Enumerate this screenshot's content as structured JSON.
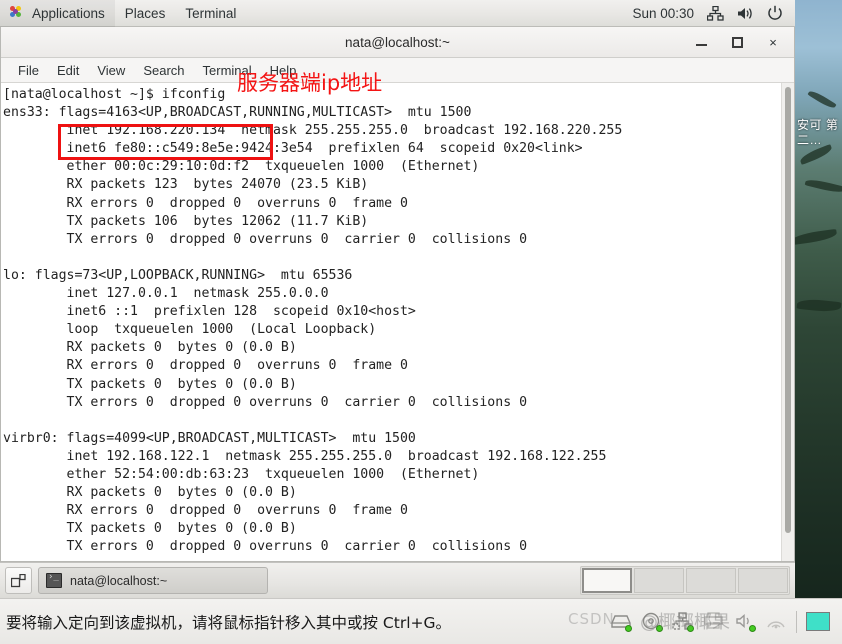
{
  "top_panel": {
    "applications_label": "Applications",
    "places_label": "Places",
    "terminal_label": "Terminal",
    "clock": "Sun 00:30",
    "icons": [
      "network-icon",
      "volume-icon",
      "power-icon"
    ]
  },
  "window": {
    "title": "nata@localhost:~",
    "menu": [
      "File",
      "Edit",
      "View",
      "Search",
      "Terminal",
      "Help"
    ],
    "buttons": {
      "minimize": "minimize-button",
      "maximize": "maximize-button",
      "close": "×"
    }
  },
  "terminal": {
    "lines": [
      "[nata@localhost ~]$ ifconfig",
      "ens33: flags=4163<UP,BROADCAST,RUNNING,MULTICAST>  mtu 1500",
      "        inet 192.168.220.134  netmask 255.255.255.0  broadcast 192.168.220.255",
      "        inet6 fe80::c549:8e5e:9424:3e54  prefixlen 64  scopeid 0x20<link>",
      "        ether 00:0c:29:10:0d:f2  txqueuelen 1000  (Ethernet)",
      "        RX packets 123  bytes 24070 (23.5 KiB)",
      "        RX errors 0  dropped 0  overruns 0  frame 0",
      "        TX packets 106  bytes 12062 (11.7 KiB)",
      "        TX errors 0  dropped 0 overruns 0  carrier 0  collisions 0",
      "",
      "lo: flags=73<UP,LOOPBACK,RUNNING>  mtu 65536",
      "        inet 127.0.0.1  netmask 255.0.0.0",
      "        inet6 ::1  prefixlen 128  scopeid 0x10<host>",
      "        loop  txqueuelen 1000  (Local Loopback)",
      "        RX packets 0  bytes 0 (0.0 B)",
      "        RX errors 0  dropped 0  overruns 0  frame 0",
      "        TX packets 0  bytes 0 (0.0 B)",
      "        TX errors 0  dropped 0 overruns 0  carrier 0  collisions 0",
      "",
      "virbr0: flags=4099<UP,BROADCAST,MULTICAST>  mtu 1500",
      "        inet 192.168.122.1  netmask 255.255.255.0  broadcast 192.168.122.255",
      "        ether 52:54:00:db:63:23  txqueuelen 1000  (Ethernet)",
      "        RX packets 0  bytes 0 (0.0 B)",
      "        RX errors 0  dropped 0  overruns 0  frame 0",
      "        TX packets 0  bytes 0 (0.0 B)",
      "        TX errors 0  dropped 0 overruns 0  carrier 0  collisions 0"
    ]
  },
  "annotation": {
    "note_text": "服务器端ip地址",
    "note_color": "#f41414",
    "highlight_target": "inet 192.168.220.134",
    "box_color": "#ee1111"
  },
  "taskbar": {
    "show_desktop": "show-desktop-button",
    "window_item": "nata@localhost:~",
    "workspace_count": 4,
    "active_workspace": 1
  },
  "vm_status": {
    "message": "要将输入定向到该虚拟机，请将鼠标指针移入其中或按 Ctrl+G。",
    "devices": [
      "harddisk-icon",
      "cdrom-icon",
      "network-icon",
      "printer-icon",
      "sound-icon",
      "usb-icon"
    ]
  },
  "watermark": {
    "brand": "CSDN",
    "author": "@椰椰椰果"
  },
  "desktop": {
    "wallpaper_text": "安可\n第二…"
  }
}
